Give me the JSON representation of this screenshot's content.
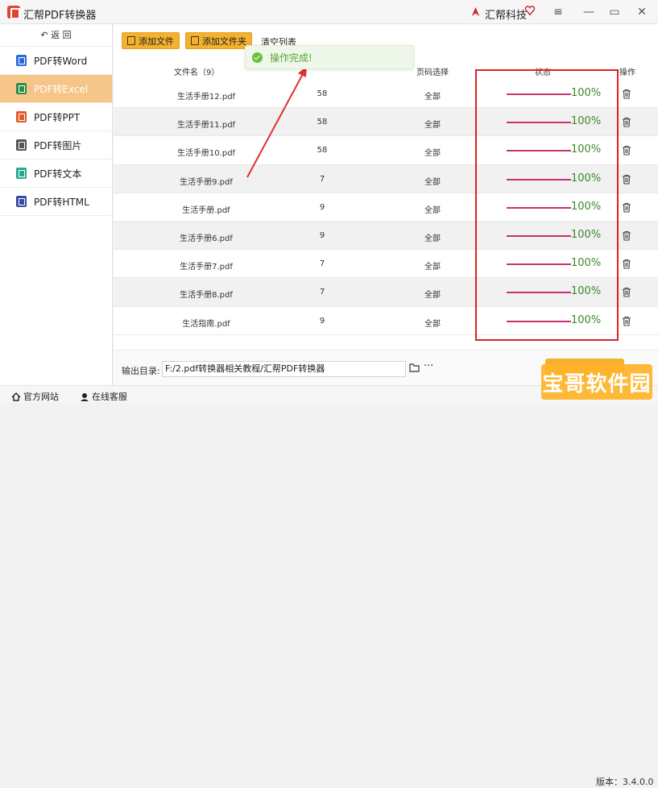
{
  "app": {
    "title": "汇帮PDF转换器",
    "brand": "汇帮科技"
  },
  "window": {
    "menu_icon": "≡",
    "minimize": "—",
    "maximize": "▭",
    "close": "✕"
  },
  "sidebar": {
    "back_label": "↶ 返  回",
    "items": [
      {
        "label": "PDF转Word",
        "icon": "word-icon",
        "color": "#2b6bd6"
      },
      {
        "label": "PDF转Excel",
        "icon": "excel-icon",
        "color": "#2a8d47",
        "active": true
      },
      {
        "label": "PDF转PPT",
        "icon": "ppt-icon",
        "color": "#e05a2b"
      },
      {
        "label": "PDF转图片",
        "icon": "image-icon",
        "color": "#555555"
      },
      {
        "label": "PDF转文本",
        "icon": "text-icon",
        "color": "#2aa88f"
      },
      {
        "label": "PDF转HTML",
        "icon": "html-icon",
        "color": "#3a4aa0"
      }
    ]
  },
  "toolbar": {
    "add_file": "添加文件",
    "add_folder": "添加文件夹",
    "clear_list": "清空列表"
  },
  "toast": {
    "message": "操作完成!"
  },
  "table": {
    "headers": {
      "name": "文件名（9）",
      "pages": "页码选择",
      "status": "状态",
      "action": "操作"
    },
    "rows": [
      {
        "name": "生活手册12.pdf",
        "pages": "58",
        "range": "全部",
        "progress": "100%"
      },
      {
        "name": "生活手册11.pdf",
        "pages": "58",
        "range": "全部",
        "progress": "100%"
      },
      {
        "name": "生活手册10.pdf",
        "pages": "58",
        "range": "全部",
        "progress": "100%"
      },
      {
        "name": "生活手册9.pdf",
        "pages": "7",
        "range": "全部",
        "progress": "100%"
      },
      {
        "name": "生活手册.pdf",
        "pages": "9",
        "range": "全部",
        "progress": "100%"
      },
      {
        "name": "生活手册6.pdf",
        "pages": "9",
        "range": "全部",
        "progress": "100%"
      },
      {
        "name": "生活手册7.pdf",
        "pages": "7",
        "range": "全部",
        "progress": "100%"
      },
      {
        "name": "生活手册8.pdf",
        "pages": "7",
        "range": "全部",
        "progress": "100%"
      },
      {
        "name": "生活指南.pdf",
        "pages": "9",
        "range": "全部",
        "progress": "100%"
      }
    ]
  },
  "output": {
    "label": "输出目录:",
    "path": "F:/2.pdf转换器相关教程/汇帮PDF转换器",
    "more": "···"
  },
  "statusbar": {
    "website": "官方网站",
    "service": "在线客服",
    "version": "版本：3.4.0.0"
  },
  "watermark": {
    "text": "宝哥软件园"
  },
  "colors": {
    "accent": "#f3b12e",
    "progress": "#c8326e",
    "highlight_box": "#e02020"
  }
}
